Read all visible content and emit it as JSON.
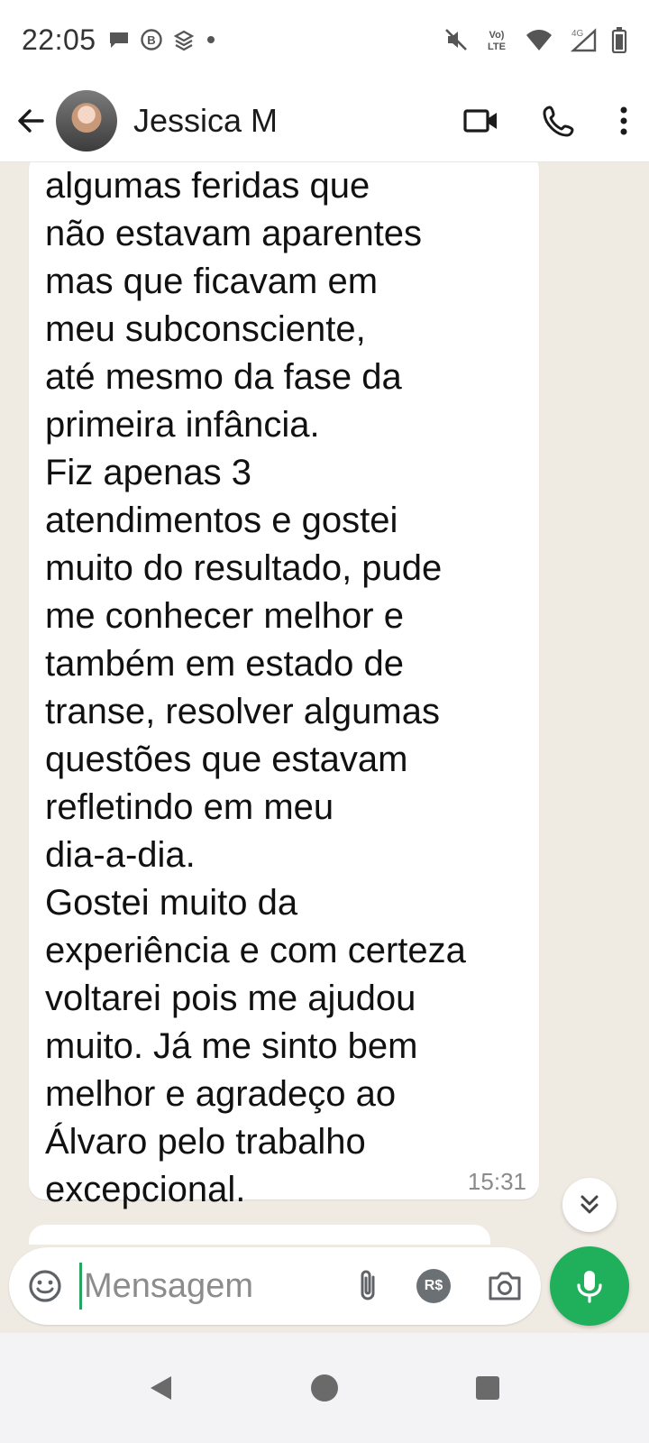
{
  "status_bar": {
    "time": "22:05",
    "network_label": "Vo) LTE",
    "net_type": "4G",
    "icons": [
      "chat-bubble-icon",
      "b-circle-icon",
      "stack-icon",
      "dot-icon",
      "mute-icon",
      "volte-icon",
      "wifi-icon",
      "signal-icon",
      "battery-icon"
    ]
  },
  "header": {
    "contact_name": "Jessica M",
    "icons": [
      "back-arrow-icon",
      "video-call-icon",
      "phone-icon",
      "more-options-icon"
    ]
  },
  "message": {
    "text": "algumas feridas que\nnão estavam aparentes\nmas que ficavam em\nmeu subconsciente,\naté mesmo da fase da\nprimeira infância.\nFiz apenas 3\natendimentos e gostei\nmuito do resultado, pude\nme conhecer melhor e\ntambém em estado de\ntranse, resolver algumas\nquestões que estavam\nrefletindo em meu\ndia-a-dia.\nGostei muito da\nexperiência e com certeza\nvoltarei pois me ajudou\nmuito. Já me sinto bem\nmelhor e agradeço ao\nÁlvaro pelo trabalho\nexcepcional.",
    "time": "15:31"
  },
  "composer": {
    "placeholder": "Mensagem",
    "pay_label": "R$",
    "icons": [
      "emoji-icon",
      "attach-icon",
      "payment-icon",
      "camera-icon",
      "mic-icon"
    ]
  },
  "colors": {
    "chat_background": "#efeae2",
    "bubble": "#ffffff",
    "accent_green": "#20b05c"
  }
}
